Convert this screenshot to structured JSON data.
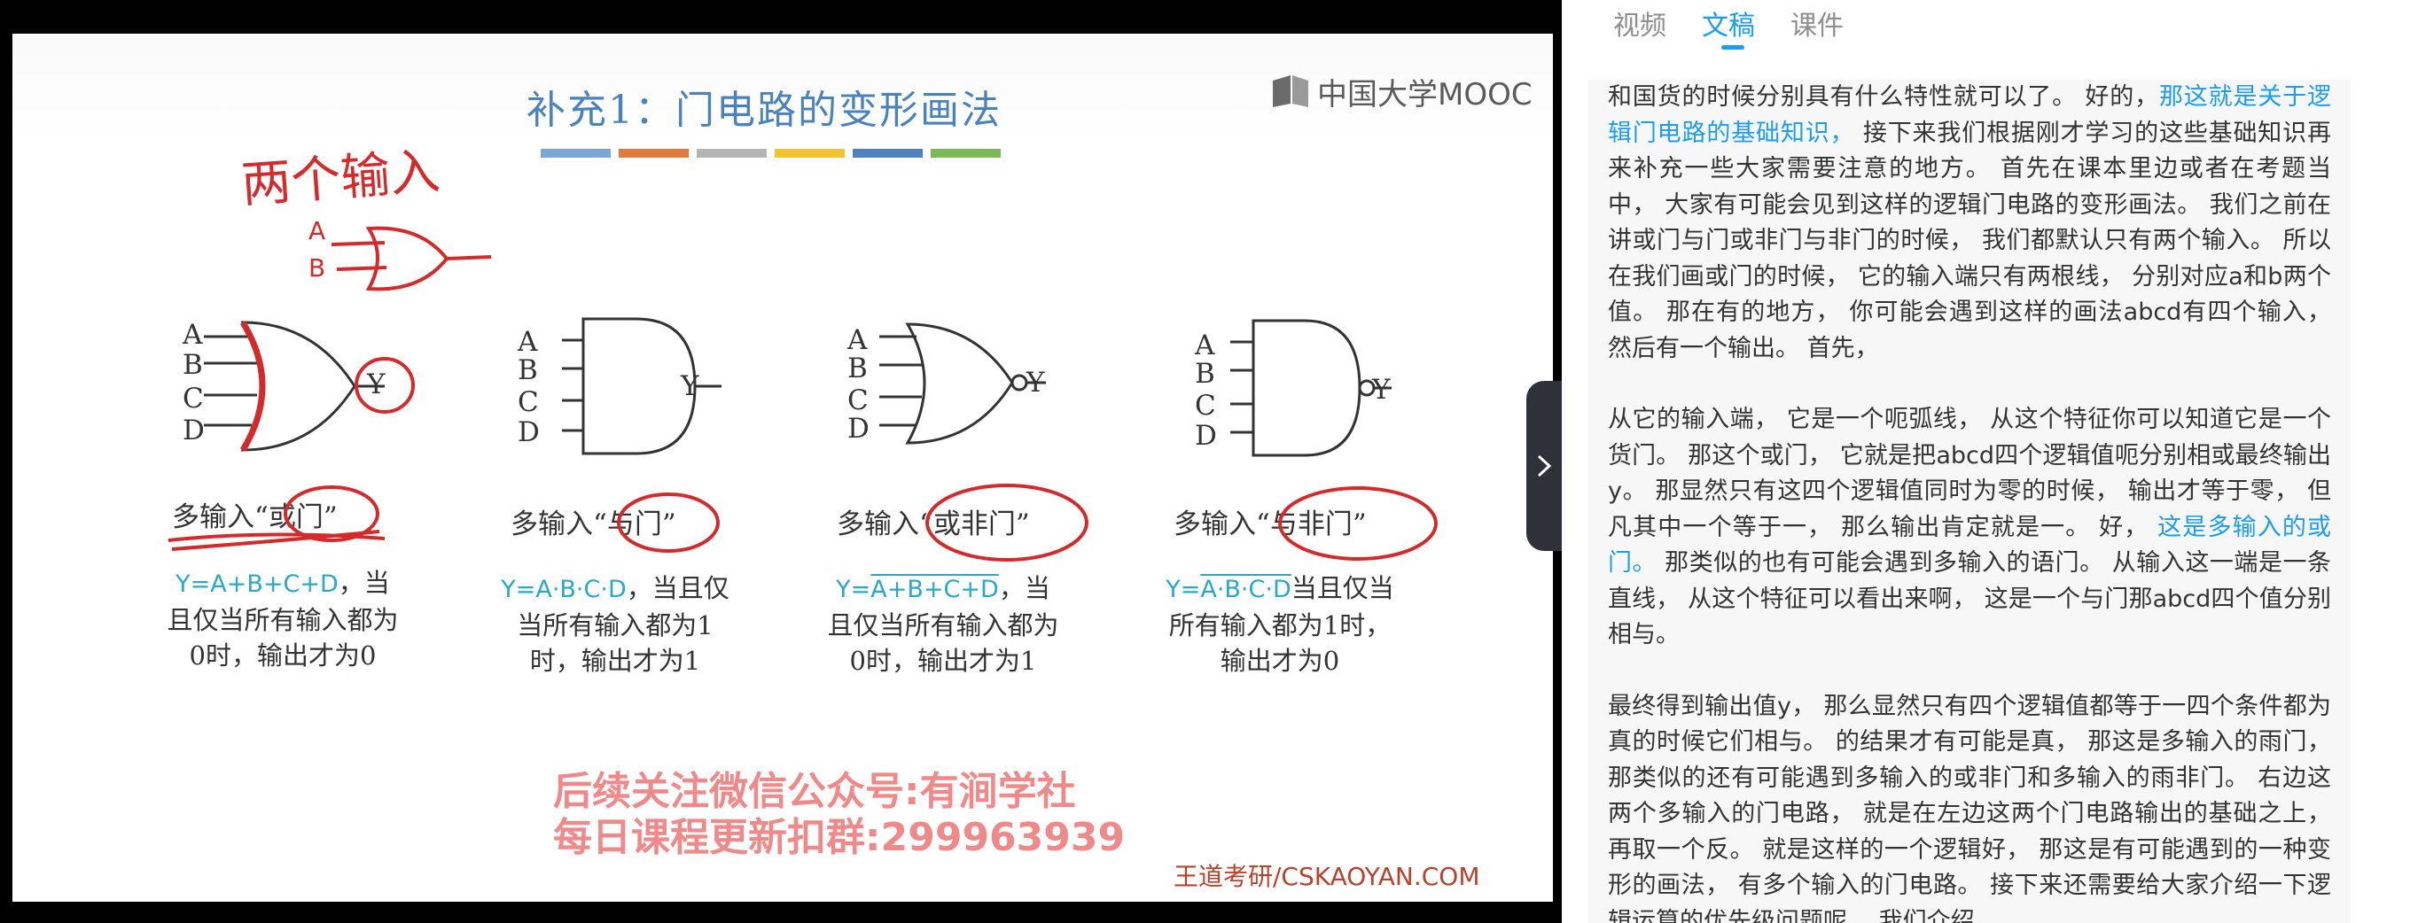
{
  "slide": {
    "title": "补充1：门电路的变形画法",
    "logo_text": "中国大学MOOC",
    "title_bar_colors": [
      "#7ba7d6",
      "#e07b3f",
      "#b4b4b4",
      "#f1c232",
      "#4f81bd",
      "#7cba59"
    ],
    "handwritten_note": "两个输入",
    "inputs": [
      "A",
      "B",
      "C",
      "D"
    ],
    "hand_inputs": [
      "A",
      "B"
    ],
    "output": "Y",
    "gates": [
      {
        "label": "多输入“或门”",
        "formula_eq": "Y=A+B+C+D",
        "formula_rest": "，当且仅当所有输入都为0时，输出才为0"
      },
      {
        "label": "多输入“与门”",
        "formula_eq": "Y=A·B·C·D",
        "formula_rest": "，当且仅当所有输入都为1时，输出才为1"
      },
      {
        "label": "多输入“或非门”",
        "formula_prefix": "Y=",
        "formula_over": "A+B+C+D",
        "formula_rest": "，当且仅当所有输入都为0时，输出才为1"
      },
      {
        "label": "多输入“与非门”",
        "formula_prefix": "Y=",
        "formula_over": "A·B·C·D",
        "formula_rest": "当且仅当所有输入都为1时，输出才为0"
      }
    ],
    "promo_line1": "后续关注微信公众号:有涧学社",
    "promo_line2": "每日课程更新扣群:299963939",
    "watermark": "王道考研/CSKAOYAN.COM"
  },
  "tabs": [
    {
      "label": "视频",
      "active": false
    },
    {
      "label": "文稿",
      "active": true
    },
    {
      "label": "课件",
      "active": false
    }
  ],
  "transcript": {
    "p1_a": "和国货的时候分别具有什么特性就可以了。 好的，",
    "p1_hl": "那这就是关于逻辑门电路的基础知识，",
    "p1_b": " 接下来我们根据刚才学习的这些基础知识再来补充一些大家需要注意的地方。 首先在课本里边或者在考题当中， 大家有可能会见到这样的逻辑门电路的变形画法。 我们之前在讲或门与门或非门与非门的时候， 我们都默认只有两个输入。 所以在我们画或门的时候， 它的输入端只有两根线， 分别对应a和b两个值。 那在有的地方， 你可能会遇到这样的画法abcd有四个输入， 然后有一个输出。 首先，",
    "p2_a": "从它的输入端， 它是一个呃弧线， 从这个特征你可以知道它是一个货门。 那这个或门， 它就是把abcd四个逻辑值呃分别相或最终输出y。 那显然只有这四个逻辑值同时为零的时候， 输出才等于零， 但凡其中一个等于一， 那么输出肯定就是一。 好， ",
    "p2_hl": "这是多输入的或门。",
    "p2_b": " 那类似的也有可能会遇到多输入的语门。 从输入这一端是一条直线， 从这个特征可以看出来啊， 这是一个与门那abcd四个值分别相与。",
    "p3": "最终得到输出值y， 那么显然只有四个逻辑值都等于一四个条件都为真的时候它们相与。 的结果才有可能是真， 那这是多输入的雨门， 那类似的还有可能遇到多输入的或非门和多输入的雨非门。 右边这两个多输入的门电路， 就是在左边这两个门电路输出的基础之上， 再取一个反。 就是这样的一个逻辑好， 那这是有可能遇到的一种变形的画法， 有多个输入的门电路。 接下来还需要给大家介绍一下逻辑运算的优先级问题呢， 我们介绍"
  }
}
